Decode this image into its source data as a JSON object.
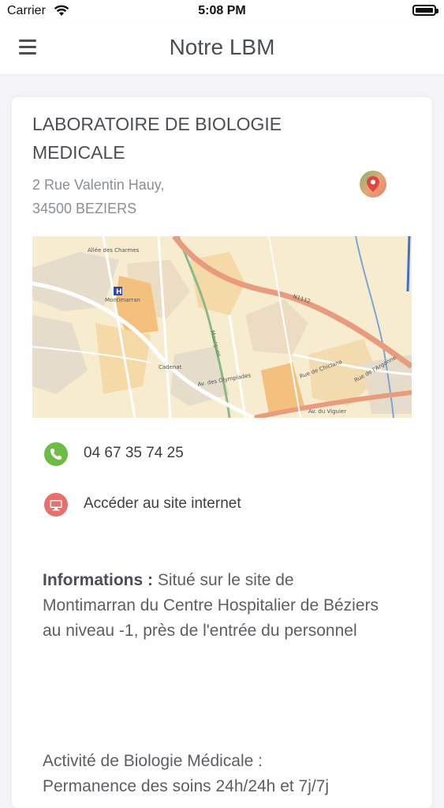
{
  "status_bar": {
    "carrier": "Carrier",
    "time": "5:08 PM"
  },
  "nav": {
    "title": "Notre LBM"
  },
  "lab": {
    "title_line1": "LABORATOIRE DE BIOLOGIE",
    "title_line2": "MEDICALE",
    "address_line1": "2 Rue Valentin Hauy,",
    "address_line2": "34500 BEZIERS"
  },
  "map_labels": {
    "street1": "Allée des Charmes",
    "hospital": "Montimarran",
    "road": "N1112",
    "street2": "Cadenat",
    "street3": "Av. des Olympiades",
    "street4": "Rue de Chiclana",
    "street5": "Av. du Viguier",
    "street6": "Rue de l'Argonne",
    "river": "Mourgues"
  },
  "contacts": {
    "phone": "04 67 35 74 25",
    "website": "Accéder au site internet"
  },
  "info": {
    "label": "Informations :",
    "text": " Situé sur le site de Montimarran du Centre Hospitalier de Béziers au niveau -1, près de l'entrée du personnel"
  },
  "activity": {
    "line1": "Activité de Biologie Médicale :",
    "line2": "Permanence des soins 24h/24h et 7j/7j"
  },
  "colors": {
    "phone_icon": "#6dbd45",
    "web_icon": "#e8706a",
    "map_bg": "#f7eccf",
    "road_main": "#e89b7d"
  },
  "icons": {
    "menu": "hamburger-icon",
    "pin": "map-pin-icon",
    "phone": "phone-icon",
    "web": "computer-icon"
  }
}
